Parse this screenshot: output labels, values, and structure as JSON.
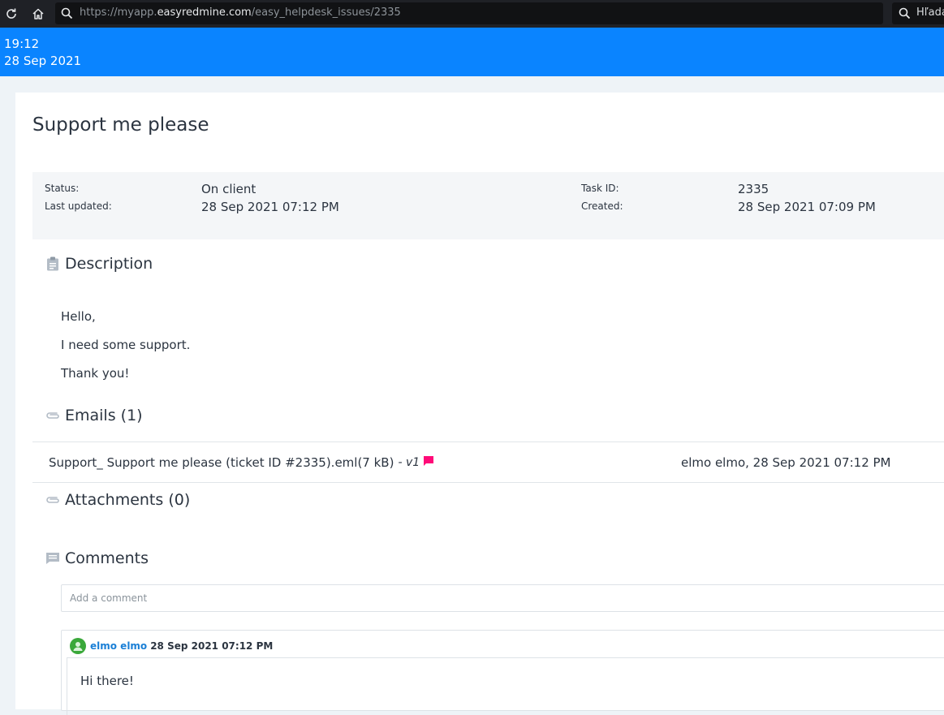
{
  "browser": {
    "url_prefix": "https://myapp.",
    "url_domain": "easyredmine.com",
    "url_path": "/easy_helpdesk_issues/2335",
    "search_text": "Hľadať"
  },
  "header": {
    "time": "19:12",
    "date": "28 Sep 2021"
  },
  "ticket": {
    "title": "Support me please",
    "status_label": "Status:",
    "status_value": "On client",
    "updated_label": "Last updated:",
    "updated_value": "28 Sep 2021 07:12 PM",
    "taskid_label": "Task ID:",
    "taskid_value": "2335",
    "created_label": "Created:",
    "created_value": "28 Sep 2021 07:09 PM"
  },
  "description": {
    "heading": "Description",
    "lines": [
      "Hello,",
      "I need some support.",
      "Thank you!"
    ]
  },
  "emails": {
    "heading": "Emails (1)",
    "items": [
      {
        "file": "Support_ Support me please (ticket ID #2335).eml(7 kB)",
        "version": "- v1",
        "meta": "elmo elmo, 28 Sep 2021 07:12 PM"
      }
    ]
  },
  "attachments": {
    "heading": "Attachments (0)"
  },
  "comments": {
    "heading": "Comments",
    "placeholder": "Add a comment",
    "items": [
      {
        "author": "elmo elmo",
        "date": "28 Sep 2021 07:12 PM",
        "text": "Hi there!"
      }
    ]
  },
  "colors": {
    "header_blue": "#0a84ff",
    "flag_pink": "#ff0a78",
    "author_link": "#1a7fd6"
  }
}
